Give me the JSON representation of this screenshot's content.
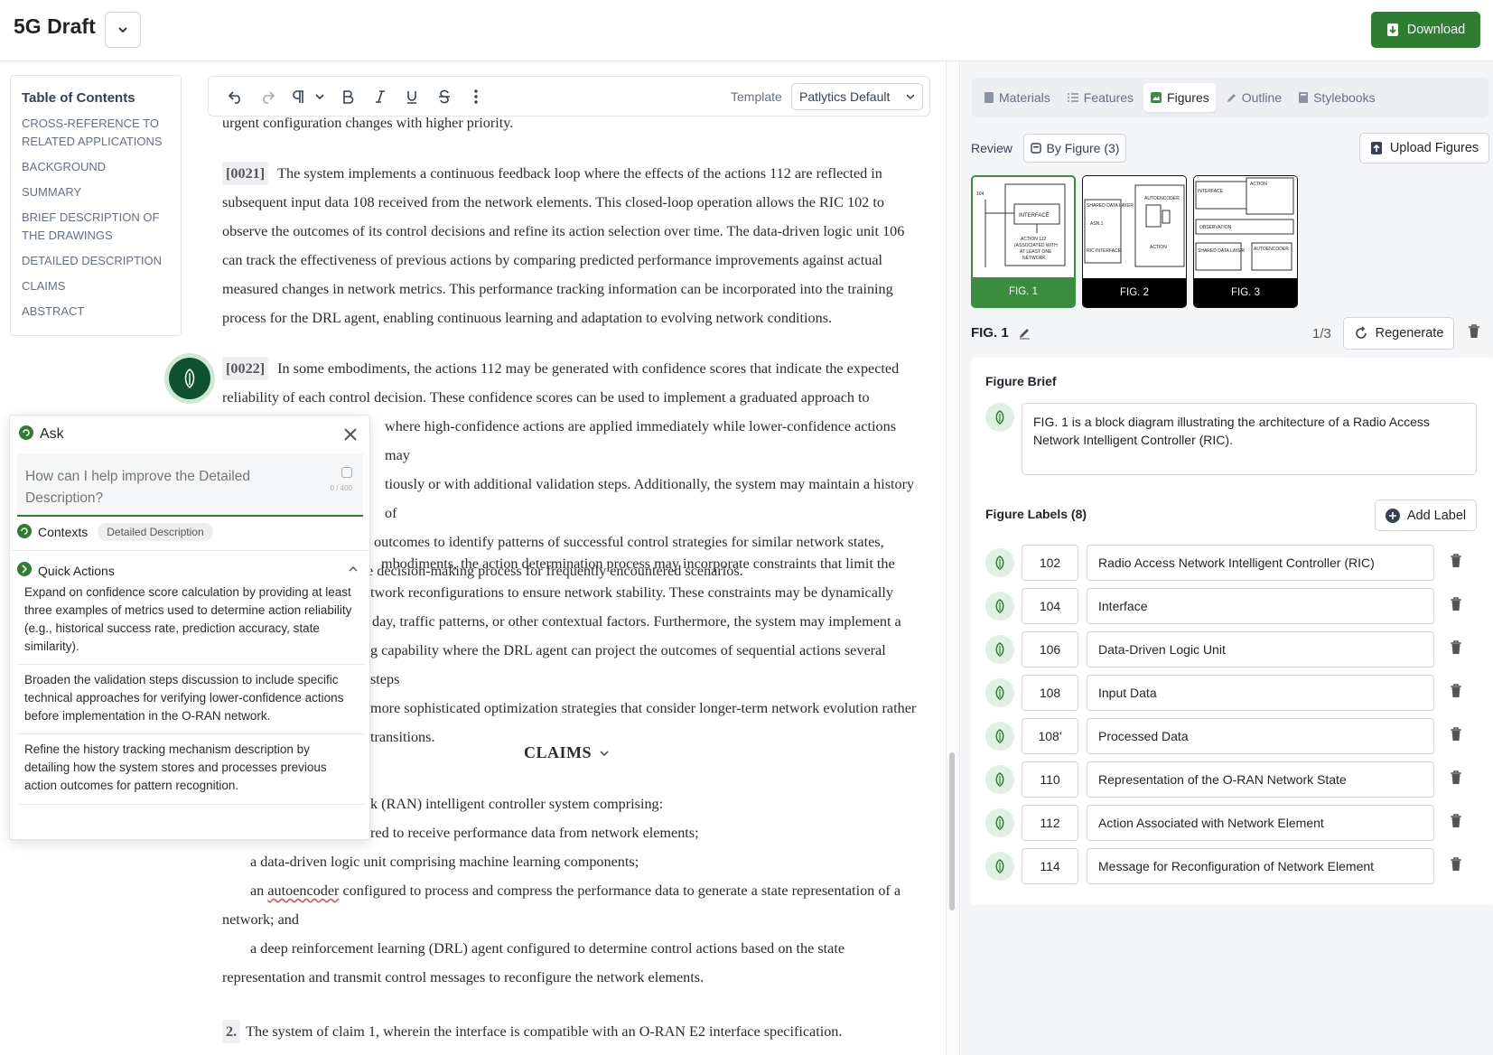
{
  "header": {
    "doc_title": "5G Draft",
    "download_label": "Download",
    "accent_color": "#2e7d32"
  },
  "toc": {
    "title": "Table of Contents",
    "items": [
      "CROSS-REFERENCE TO RELATED APPLICATIONS",
      "BACKGROUND",
      "SUMMARY",
      "BRIEF DESCRIPTION OF THE DRAWINGS",
      "DETAILED DESCRIPTION",
      "CLAIMS",
      "ABSTRACT"
    ]
  },
  "toolbar": {
    "icons": [
      "undo-icon",
      "redo-icon",
      "paragraph-icon",
      "bold-icon",
      "italic-icon",
      "underline-icon",
      "strikethrough-icon",
      "more-vertical-icon"
    ],
    "template_label": "Template",
    "template_value": "Patlytics Default"
  },
  "document": {
    "top_fragment": "urgent configuration changes with higher priority.",
    "para_0021": {
      "num": "[0021]",
      "text": "The system implements a continuous feedback loop where the effects of the actions 112 are reflected in subsequent input data 108 received from the network elements. This closed-loop operation allows the RIC 102 to observe the outcomes of its control decisions and refine its action selection over time. The data-driven logic unit 106 can track the effectiveness of previous actions by comparing predicted performance improvements against actual measured changes in network metrics. This performance tracking information can be incorporated into the training process for the DRL agent, enabling continuous learning and adaptation to evolving network conditions."
    },
    "para_0022": {
      "num": "[0022]",
      "line1": "In some embodiments, the actions 112 may be generated with confidence scores that indicate the expected",
      "line2": "reliability of each control decision. These confidence scores can be used to implement a graduated approach to",
      "line3": "where high-confidence actions are applied immediately while lower-confidence actions may",
      "line4": "tiously or with additional validation steps. Additionally, the system may maintain a history of",
      "line5": "outcomes to identify patterns of successful control strategies for similar network states,",
      "line6": "e decision-making process for frequently encountered scenarios."
    },
    "para_0023": {
      "line1": "mbodiments, the action determination process may incorporate constraints that limit the",
      "line2": "twork reconfigurations to ensure network stability. These constraints may be dynamically",
      "line3": "day, traffic patterns, or other contextual factors. Furthermore, the system may implement a",
      "line4": "g capability where the DRL agent can project the outcomes of sequential actions several steps",
      "line5": "more sophisticated optimization strategies that consider longer-term network evolution rather",
      "line6": "transitions."
    },
    "claims_heading": "CLAIMS",
    "claim1": {
      "line1": "k (RAN) intelligent controller system comprising:",
      "line2": "red to receive performance data from network elements;",
      "line3": "a data-driven logic unit comprising machine learning components;",
      "line4_pre": "an ",
      "line4_squiggle": "autoencoder",
      "line4_post": " configured to process and compress the performance data to generate a state representation of a",
      "line5": "network; and",
      "line6": "a deep reinforcement learning (DRL) agent configured to determine control actions based on the state",
      "line7": "representation and transmit control messages to reconfigure the network elements."
    },
    "claim2": {
      "num": "2.",
      "text": "The system of claim 1, wherein the interface is compatible with an O-RAN E2 interface specification."
    }
  },
  "ask_panel": {
    "title": "Ask",
    "placeholder": "How can I help improve the Detailed Description?",
    "counter": "0 / 400",
    "contexts_label": "Contexts",
    "context_chip": "Detailed Description",
    "quick_actions_title": "Quick Actions",
    "quick_actions": [
      "Expand on confidence score calculation by providing at least three examples of metrics used to determine action reliability (e.g., historical success rate, prediction accuracy, state similarity).",
      "Broaden the validation steps discussion to include specific technical approaches for verifying lower-confidence actions before implementation in the O-RAN network.",
      "Refine the history tracking mechanism description by detailing how the system stores and processes previous action outcomes for pattern recognition."
    ]
  },
  "right_panel": {
    "tabs": [
      {
        "label": "Materials",
        "icon": "file-icon"
      },
      {
        "label": "Features",
        "icon": "list-icon"
      },
      {
        "label": "Figures",
        "icon": "image-icon",
        "active": true
      },
      {
        "label": "Outline",
        "icon": "pencil-icon"
      },
      {
        "label": "Stylebooks",
        "icon": "book-icon"
      }
    ],
    "review_label": "Review",
    "by_figure_label": "By Figure (3)",
    "upload_label": "Upload Figures",
    "thumbnails": [
      {
        "label": "FIG. 1",
        "active": true
      },
      {
        "label": "FIG. 2"
      },
      {
        "label": "FIG. 3"
      }
    ],
    "fig_name": "FIG. 1",
    "fig_counter": "1/3",
    "regenerate_label": "Regenerate",
    "brief_title": "Figure Brief",
    "brief_text": "FIG. 1 is a block diagram illustrating the architecture of a Radio Access Network Intelligent Controller (RIC).",
    "labels_title": "Figure Labels (8)",
    "add_label": "Add Label",
    "labels": [
      {
        "num": "102",
        "text": "Radio Access Network Intelligent Controller (RIC)"
      },
      {
        "num": "104",
        "text": "Interface"
      },
      {
        "num": "106",
        "text": "Data-Driven Logic Unit"
      },
      {
        "num": "108",
        "text": "Input Data"
      },
      {
        "num": "108'",
        "text": "Processed Data"
      },
      {
        "num": "110",
        "text": "Representation of the O-RAN Network State"
      },
      {
        "num": "112",
        "text": "Action Associated with Network Element"
      },
      {
        "num": "114",
        "text": "Message for Reconfiguration of Network Element"
      }
    ]
  }
}
